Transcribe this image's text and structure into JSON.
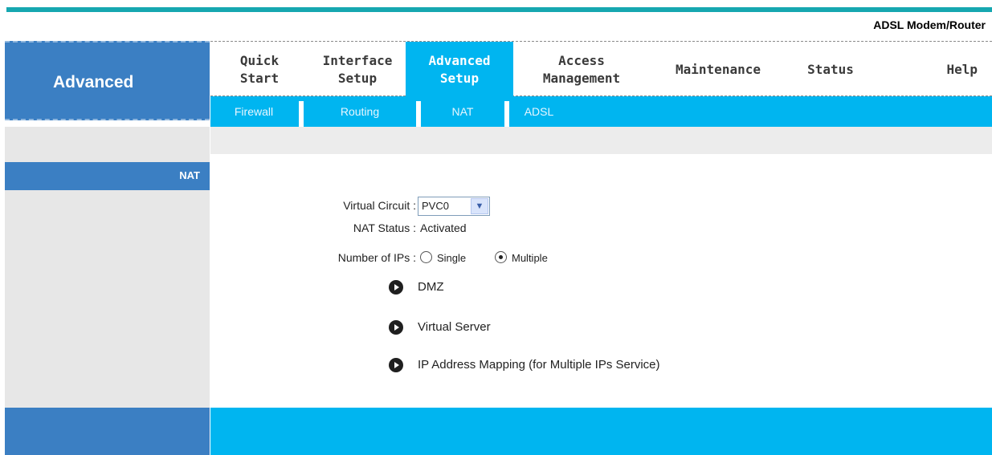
{
  "header": {
    "brand": "ADSL Modem/Router"
  },
  "sidebar": {
    "title": "Advanced",
    "section": "NAT"
  },
  "menu": {
    "items": [
      {
        "label": "Quick\nStart"
      },
      {
        "label": "Interface\nSetup"
      },
      {
        "label": "Advanced\nSetup"
      },
      {
        "label": "Access\nManagement"
      },
      {
        "label": "Maintenance"
      },
      {
        "label": "Status"
      },
      {
        "label": "Help"
      }
    ],
    "active": "Advanced Setup"
  },
  "submenu": {
    "items": [
      {
        "label": "Firewall"
      },
      {
        "label": "Routing"
      },
      {
        "label": "NAT"
      },
      {
        "label": "ADSL"
      }
    ]
  },
  "form": {
    "virtual_circuit_label": "Virtual Circuit :",
    "virtual_circuit_value": "PVC0",
    "nat_status_label": "NAT Status :",
    "nat_status_value": "Activated",
    "num_ips_label": "Number of IPs :",
    "single_label": "Single",
    "multiple_label": "Multiple",
    "selected": "Multiple"
  },
  "links": [
    {
      "label": "DMZ"
    },
    {
      "label": "Virtual Server"
    },
    {
      "label": "IP Address Mapping (for Multiple IPs Service)"
    }
  ],
  "colors": {
    "accent": "#00b5f0",
    "sidebar_blue": "#3b7fc3",
    "top_bar": "#16a7b0"
  }
}
